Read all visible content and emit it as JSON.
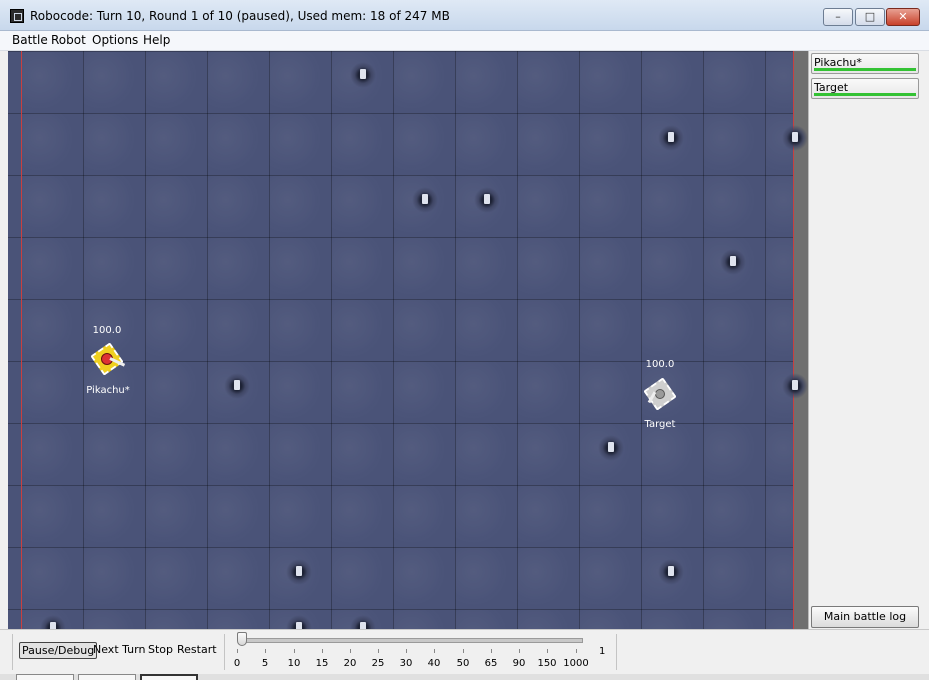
{
  "window": {
    "title": "Robocode: Turn 10, Round 1 of 10 (paused), Used mem: 18 of 247 MB",
    "controls": {
      "minimize": "–",
      "maximize": "□",
      "close": "✕"
    }
  },
  "menu": [
    "Battle",
    "Robot",
    "Options",
    "Help"
  ],
  "robots": [
    {
      "name": "Pikachu*",
      "energy": "100.0",
      "health": 1.0
    },
    {
      "name": "Target",
      "energy": "100.0",
      "health": 1.0
    }
  ],
  "side_panel": {
    "robot_buttons": [
      "Pikachu*",
      "Target"
    ],
    "log_button": "Main battle log"
  },
  "toolbar": {
    "pause": "Pause/Debug",
    "next_turn": "Next Turn",
    "stop": "Stop",
    "restart": "Restart",
    "tps_value": "1",
    "tps_ticks": [
      "0",
      "5",
      "10",
      "15",
      "20",
      "25",
      "30",
      "40",
      "50",
      "65",
      "90",
      "150",
      "1000"
    ]
  },
  "colors": {
    "arena": "#4a5378",
    "wall": "#c84040",
    "energy_bar": "#33c233"
  },
  "icons": [
    "app-icon",
    "minimize-icon",
    "maximize-icon",
    "close-icon"
  ]
}
